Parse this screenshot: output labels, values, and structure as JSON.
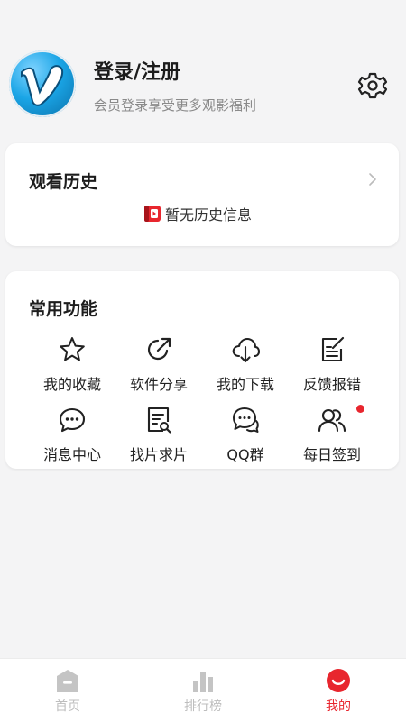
{
  "profile": {
    "title": "登录/注册",
    "subtitle": "会员登录享受更多观影福利",
    "avatar_icon": "vimeo-v-logo",
    "settings_icon": "gear-icon"
  },
  "history": {
    "title": "观看历史",
    "empty_text": "暂无历史信息",
    "empty_icon": "book-icon"
  },
  "functions": {
    "title": "常用功能",
    "items": [
      {
        "label": "我的收藏",
        "icon": "star-icon"
      },
      {
        "label": "软件分享",
        "icon": "share-icon"
      },
      {
        "label": "我的下载",
        "icon": "cloud-download-icon"
      },
      {
        "label": "反馈报错",
        "icon": "edit-note-icon"
      },
      {
        "label": "消息中心",
        "icon": "chat-bubble-icon"
      },
      {
        "label": "找片求片",
        "icon": "document-search-icon"
      },
      {
        "label": "QQ群",
        "icon": "double-chat-icon"
      },
      {
        "label": "每日签到",
        "icon": "users-icon",
        "badge": true
      }
    ]
  },
  "tabbar": {
    "tabs": [
      {
        "label": "首页",
        "icon": "home-icon",
        "active": false
      },
      {
        "label": "排行榜",
        "icon": "bar-chart-icon",
        "active": false
      },
      {
        "label": "我的",
        "icon": "smile-face-icon",
        "active": true
      }
    ]
  },
  "colors": {
    "accent": "#e8262e",
    "background": "#f4f4f5",
    "card": "#ffffff",
    "subtitle": "#8a8a8a",
    "inactive_tab": "#bdbdbd"
  }
}
